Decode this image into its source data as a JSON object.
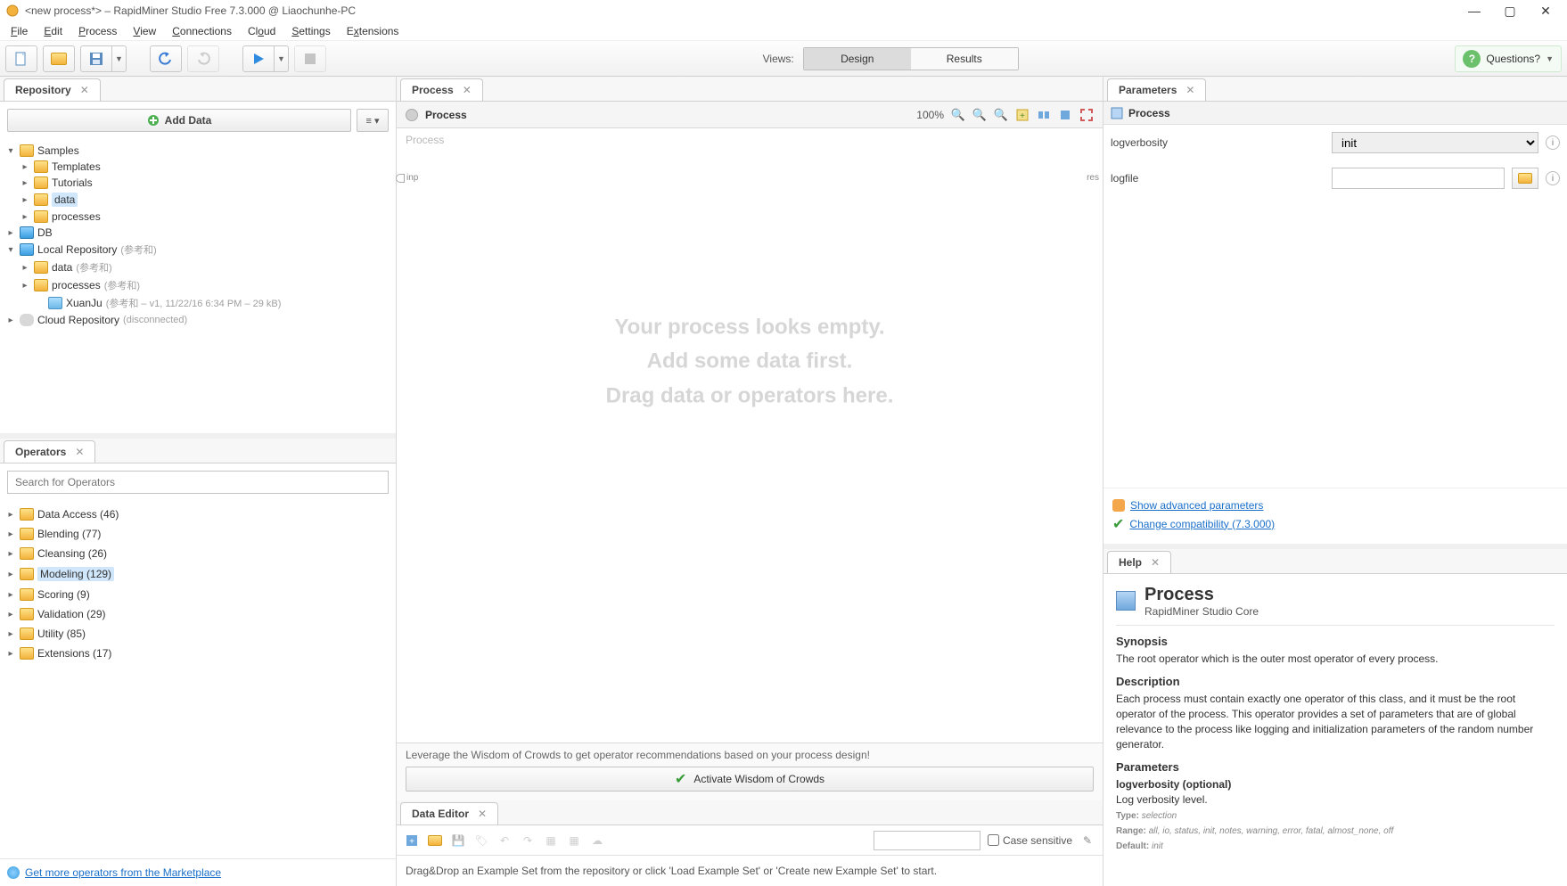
{
  "window": {
    "title": "<new process*> – RapidMiner Studio Free 7.3.000 @ Liaochunhe-PC"
  },
  "menu": [
    "File",
    "Edit",
    "Process",
    "View",
    "Connections",
    "Cloud",
    "Settings",
    "Extensions"
  ],
  "toolbar": {
    "views_label": "Views:",
    "design": "Design",
    "results": "Results",
    "questions": "Questions?"
  },
  "repository": {
    "title": "Repository",
    "add_data": "Add Data",
    "tree": {
      "samples": "Samples",
      "templates": "Templates",
      "tutorials": "Tutorials",
      "data": "data",
      "processes": "processes",
      "db": "DB",
      "local": "Local Repository",
      "local_meta": "(参考和)",
      "local_data": "data",
      "local_data_meta": "(参考和)",
      "local_processes": "processes",
      "local_processes_meta": "(参考和)",
      "xuanju": "XuanJu",
      "xuanju_meta": "(参考和  –  v1, 11/22/16 6:34 PM  –  29 kB)",
      "cloud": "Cloud Repository",
      "cloud_meta": "(disconnected)"
    }
  },
  "operators": {
    "title": "Operators",
    "placeholder": "Search for Operators",
    "items": [
      "Data Access (46)",
      "Blending (77)",
      "Cleansing (26)",
      "Modeling (129)",
      "Scoring (9)",
      "Validation (29)",
      "Utility (85)",
      "Extensions (17)"
    ],
    "marketplace": "Get more operators from the Marketplace"
  },
  "process": {
    "title": "Process",
    "breadcrumb": "Process",
    "zoom": "100%",
    "canvas_label": "Process",
    "inp": "inp",
    "res": "res",
    "empty1": "Your process looks empty.",
    "empty2": "Add some data first.",
    "empty3": "Drag data or operators here.",
    "wisdom_msg": "Leverage the Wisdom of Crowds to get operator recommendations based on your process design!",
    "wisdom_btn": "Activate Wisdom of Crowds"
  },
  "data_editor": {
    "title": "Data Editor",
    "case_sensitive": "Case sensitive",
    "hint": "Drag&Drop an Example Set from the repository or click 'Load Example Set' or 'Create new Example Set' to start."
  },
  "parameters": {
    "title": "Parameters",
    "header": "Process",
    "logverbosity_label": "logverbosity",
    "logverbosity_value": "init",
    "logfile_label": "logfile",
    "logfile_value": "",
    "show_advanced": "Show advanced parameters",
    "change_compat": "Change compatibility (7.3.000)"
  },
  "help": {
    "title": "Help",
    "heading": "Process",
    "subtitle": "RapidMiner Studio Core",
    "synopsis_h": "Synopsis",
    "synopsis": "The root operator which is the outer most operator of every process.",
    "description_h": "Description",
    "description": "Each process must contain exactly one operator of this class, and it must be the root operator of the process. This operator provides a set of parameters that are of global relevance to the process like logging and initialization parameters of the random number generator.",
    "parameters_h": "Parameters",
    "param_name": "logverbosity (optional)",
    "param_desc": "Log verbosity level.",
    "param_type_l": "Type:",
    "param_type": "selection",
    "param_range_l": "Range:",
    "param_range": "all, io, status, init, notes, warning, error, fatal, almost_none, off",
    "param_default_l": "Default:",
    "param_default": "init"
  }
}
